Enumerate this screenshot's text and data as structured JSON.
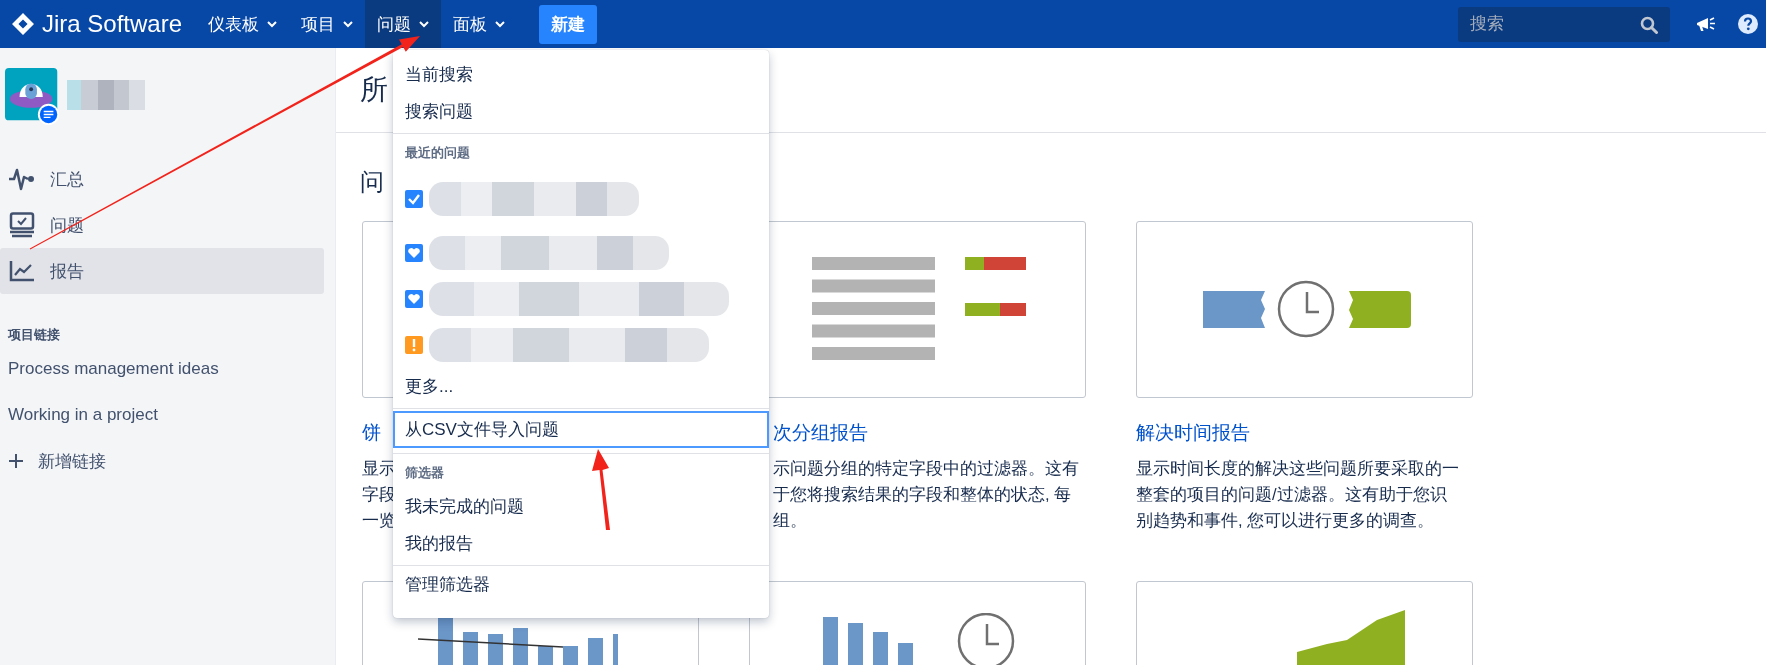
{
  "app": {
    "name": "Jira Software"
  },
  "nav": [
    {
      "label": "仪表板",
      "selected": false
    },
    {
      "label": "项目",
      "selected": false
    },
    {
      "label": "问题",
      "selected": true
    },
    {
      "label": "面板",
      "selected": false
    }
  ],
  "create_button": "新建",
  "search": {
    "placeholder": "搜索"
  },
  "sidebar": {
    "items": [
      {
        "label": "汇总",
        "kind": "pulse",
        "selected": false
      },
      {
        "label": "问题",
        "kind": "board",
        "selected": false
      },
      {
        "label": "报告",
        "kind": "chart",
        "selected": true
      }
    ],
    "links_heading": "项目链接",
    "links": [
      "Process management ideas",
      "Working in a project"
    ],
    "add_link": "新增链接"
  },
  "page": {
    "title": "所",
    "section_title": "问",
    "cards": [
      {
        "kind": "blank",
        "title": "饼",
        "description": [
          "显示",
          "字段",
          "一览"
        ]
      },
      {
        "kind": "list-bars",
        "title": "次分组报告",
        "description": [
          "示问题分组的特定字段中的过滤器。这有",
          "于您将搜索结果的字段和整体的状态, 每",
          "组。"
        ]
      },
      {
        "kind": "clock-ribbons",
        "title": "解决时间报告",
        "description": [
          "显示时间长度的解决这些问题所要采取的一",
          "整套的项目的问题/过滤器。这有助于您识",
          "别趋势和事件, 您可以进行更多的调查。"
        ]
      },
      {
        "kind": "bar-line"
      },
      {
        "kind": "bars-clock"
      },
      {
        "kind": "area"
      }
    ]
  },
  "issues_menu": {
    "sections": [
      {
        "items": [
          {
            "label": "当前搜索",
            "highlighted": false
          },
          {
            "label": "搜索问题",
            "highlighted": false
          }
        ]
      },
      {
        "heading": "最近的问题",
        "recent": [
          {
            "kind": "task"
          },
          {
            "kind": "heart"
          },
          {
            "kind": "heart"
          },
          {
            "kind": "alert"
          }
        ],
        "items": [
          {
            "label": "更多...",
            "highlighted": false
          }
        ]
      },
      {
        "items": [
          {
            "label": "从CSV文件导入问题",
            "highlighted": true
          }
        ]
      },
      {
        "heading": "筛选器",
        "items": [
          {
            "label": "我未完成的问题",
            "highlighted": false
          },
          {
            "label": "我的报告",
            "highlighted": false
          }
        ]
      },
      {
        "items": [
          {
            "label": "管理筛选器",
            "highlighted": false
          }
        ]
      }
    ]
  }
}
